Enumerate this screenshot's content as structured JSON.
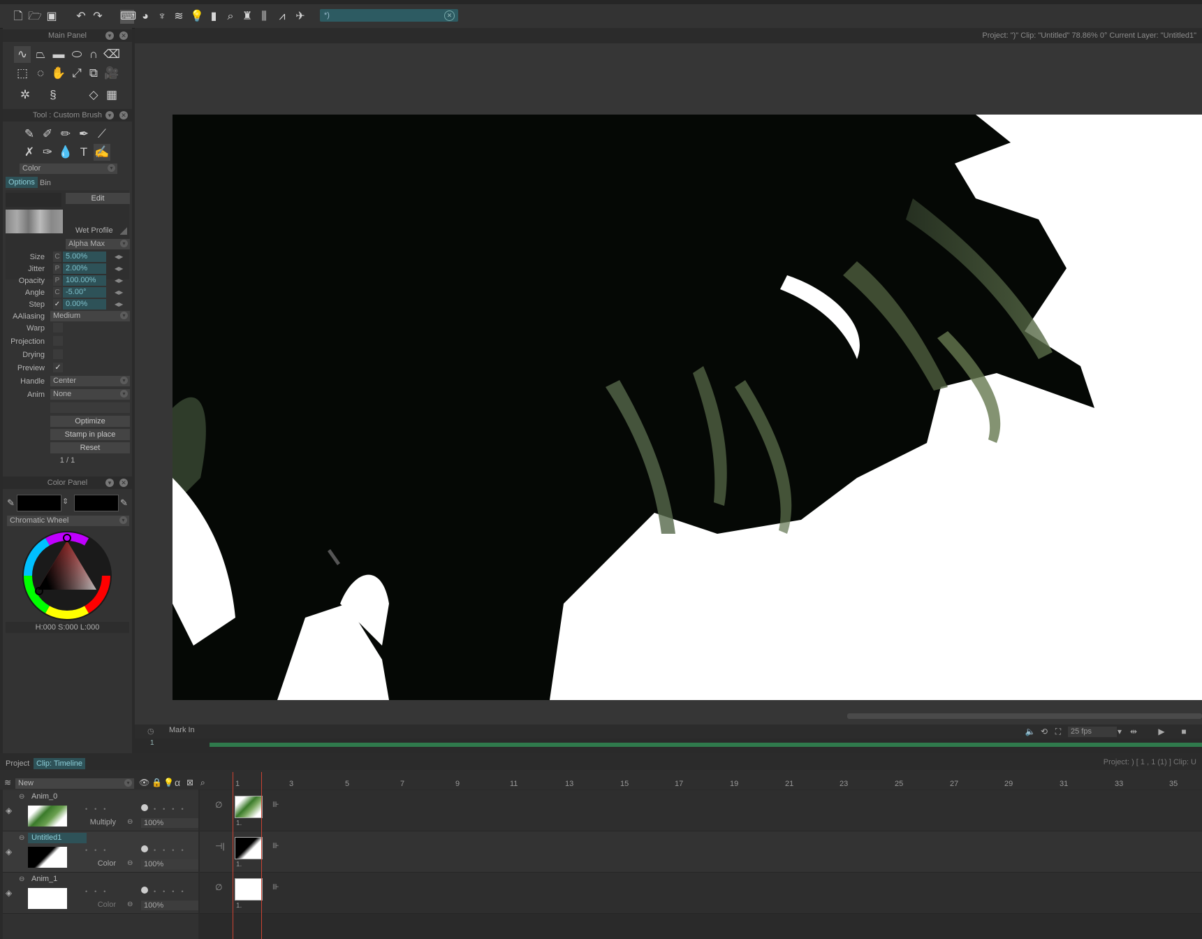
{
  "toolbar": {
    "search_value": "*)",
    "icons": [
      "new-file-icon",
      "open-folder-icon",
      "save-icon",
      "undo-icon",
      "redo-icon",
      "keyboard-icon",
      "color-icon",
      "brush-rack-icon",
      "layers-icon",
      "lightbulb-icon",
      "ruler-icon",
      "magnifier-icon",
      "stamp-icon",
      "library-icon",
      "stats-icon",
      "paper-plane-icon"
    ]
  },
  "status_bar": "Project: \")\"  Clip: \"Untitled\"  78.86%  0°  Current Layer: \"Untitled1\"",
  "main_panel": {
    "title": "Main Panel"
  },
  "tool_panel": {
    "title": "Tool : Custom Brush",
    "color_dropdown": "Color",
    "tabs": [
      "Options",
      "Bin"
    ],
    "edit_button": "Edit",
    "wet_profile": "Wet Profile",
    "alpha_mode": "Alpha Max",
    "params": [
      {
        "label": "Size",
        "mod": "C",
        "value": "5.00%"
      },
      {
        "label": "Jitter",
        "mod": "P",
        "value": "2.00%"
      },
      {
        "label": "Opacity",
        "mod": "P",
        "value": "100.00%"
      },
      {
        "label": "Angle",
        "mod": "C",
        "value": "-5.00°"
      },
      {
        "label": "Step",
        "mod": "✓",
        "value": "0.00%"
      }
    ],
    "aaliasing_label": "AAliasing",
    "aaliasing_value": "Medium",
    "warp_label": "Warp",
    "projection_label": "Projection",
    "drying_label": "Drying",
    "preview_label": "Preview",
    "handle_label": "Handle",
    "handle_value": "Center",
    "anim_label": "Anim",
    "anim_value": "None",
    "optimize_button": "Optimize",
    "stamp_button": "Stamp in place",
    "reset_button": "Reset",
    "page_counter": "1 / 1"
  },
  "color_panel": {
    "title": "Color Panel",
    "mode": "Chromatic Wheel",
    "hsl_readout": "H:000 S:000 L:000",
    "fg_color": "#000000",
    "bg_color": "#000000"
  },
  "transport": {
    "mark_in": "Mark In",
    "frame_start": "1",
    "fps": "25 fps"
  },
  "timeline": {
    "tabs": [
      "Project",
      "Clip: Timeline"
    ],
    "new_layer_label": "New",
    "status": "Project: ) [ 1 , 1  (1) ]      Clip: U",
    "ticks": [
      "1",
      "3",
      "5",
      "7",
      "9",
      "11",
      "13",
      "15",
      "17",
      "19",
      "21",
      "23",
      "25",
      "27",
      "29",
      "31",
      "33",
      "35"
    ],
    "layers": [
      {
        "name": "Anim_0",
        "mode": "Multiply",
        "opacity": "100%",
        "cel_label": "1."
      },
      {
        "name": "Untitled1",
        "mode": "Color",
        "opacity": "100%",
        "cel_label": "1."
      },
      {
        "name": "Anim_1",
        "mode": "Color",
        "opacity": "100%",
        "cel_label": "1."
      }
    ]
  }
}
